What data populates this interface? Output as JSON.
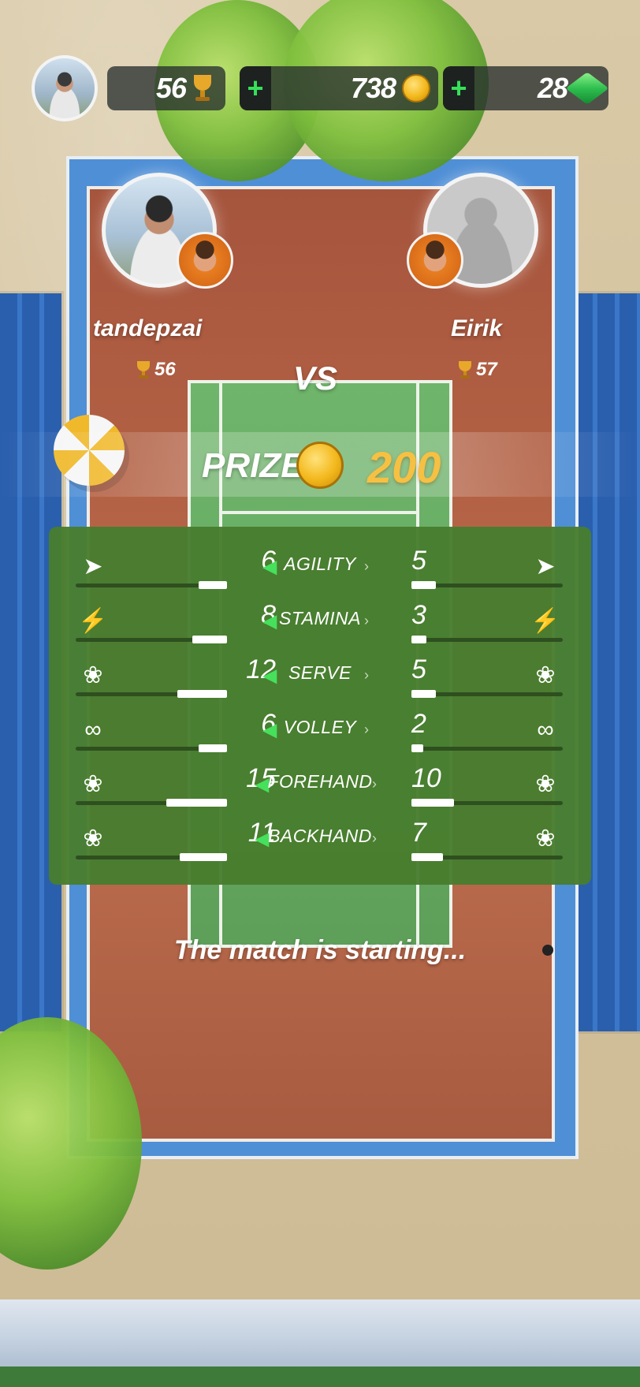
{
  "topbar": {
    "trophies": "56",
    "coins": "738",
    "gems": "28",
    "plus_label": "+",
    "icons": {
      "trophy": "trophy-icon",
      "coin": "coin-icon",
      "gem": "gem-icon",
      "avatar": "profile-avatar"
    }
  },
  "players": {
    "left": {
      "name": "tandepzai",
      "trophies": "56"
    },
    "right": {
      "name": "Eirik",
      "trophies": "57"
    },
    "vs": "VS"
  },
  "prize": {
    "label": "PRIZE",
    "amount": "200"
  },
  "stats": [
    {
      "label": "AGILITY",
      "left": "6",
      "right": "5",
      "left_fill": 0.19,
      "right_fill": 0.16,
      "icon": "shoe-icon"
    },
    {
      "label": "STAMINA",
      "left": "8",
      "right": "3",
      "left_fill": 0.23,
      "right_fill": 0.1,
      "icon": "lightning-icon"
    },
    {
      "label": "SERVE",
      "left": "12",
      "right": "5",
      "left_fill": 0.33,
      "right_fill": 0.16,
      "icon": "serve-icon"
    },
    {
      "label": "VOLLEY",
      "left": "6",
      "right": "2",
      "left_fill": 0.19,
      "right_fill": 0.08,
      "icon": "volley-icon"
    },
    {
      "label": "FOREHAND",
      "left": "15",
      "right": "10",
      "left_fill": 0.4,
      "right_fill": 0.28,
      "icon": "forehand-icon"
    },
    {
      "label": "BACKHAND",
      "left": "11",
      "right": "7",
      "left_fill": 0.31,
      "right_fill": 0.21,
      "icon": "backhand-icon"
    }
  ],
  "status": "The match is starting...",
  "colors": {
    "panel": "#487d2e",
    "accent_green": "#46e05c",
    "prize_gold": "#f6c043"
  }
}
